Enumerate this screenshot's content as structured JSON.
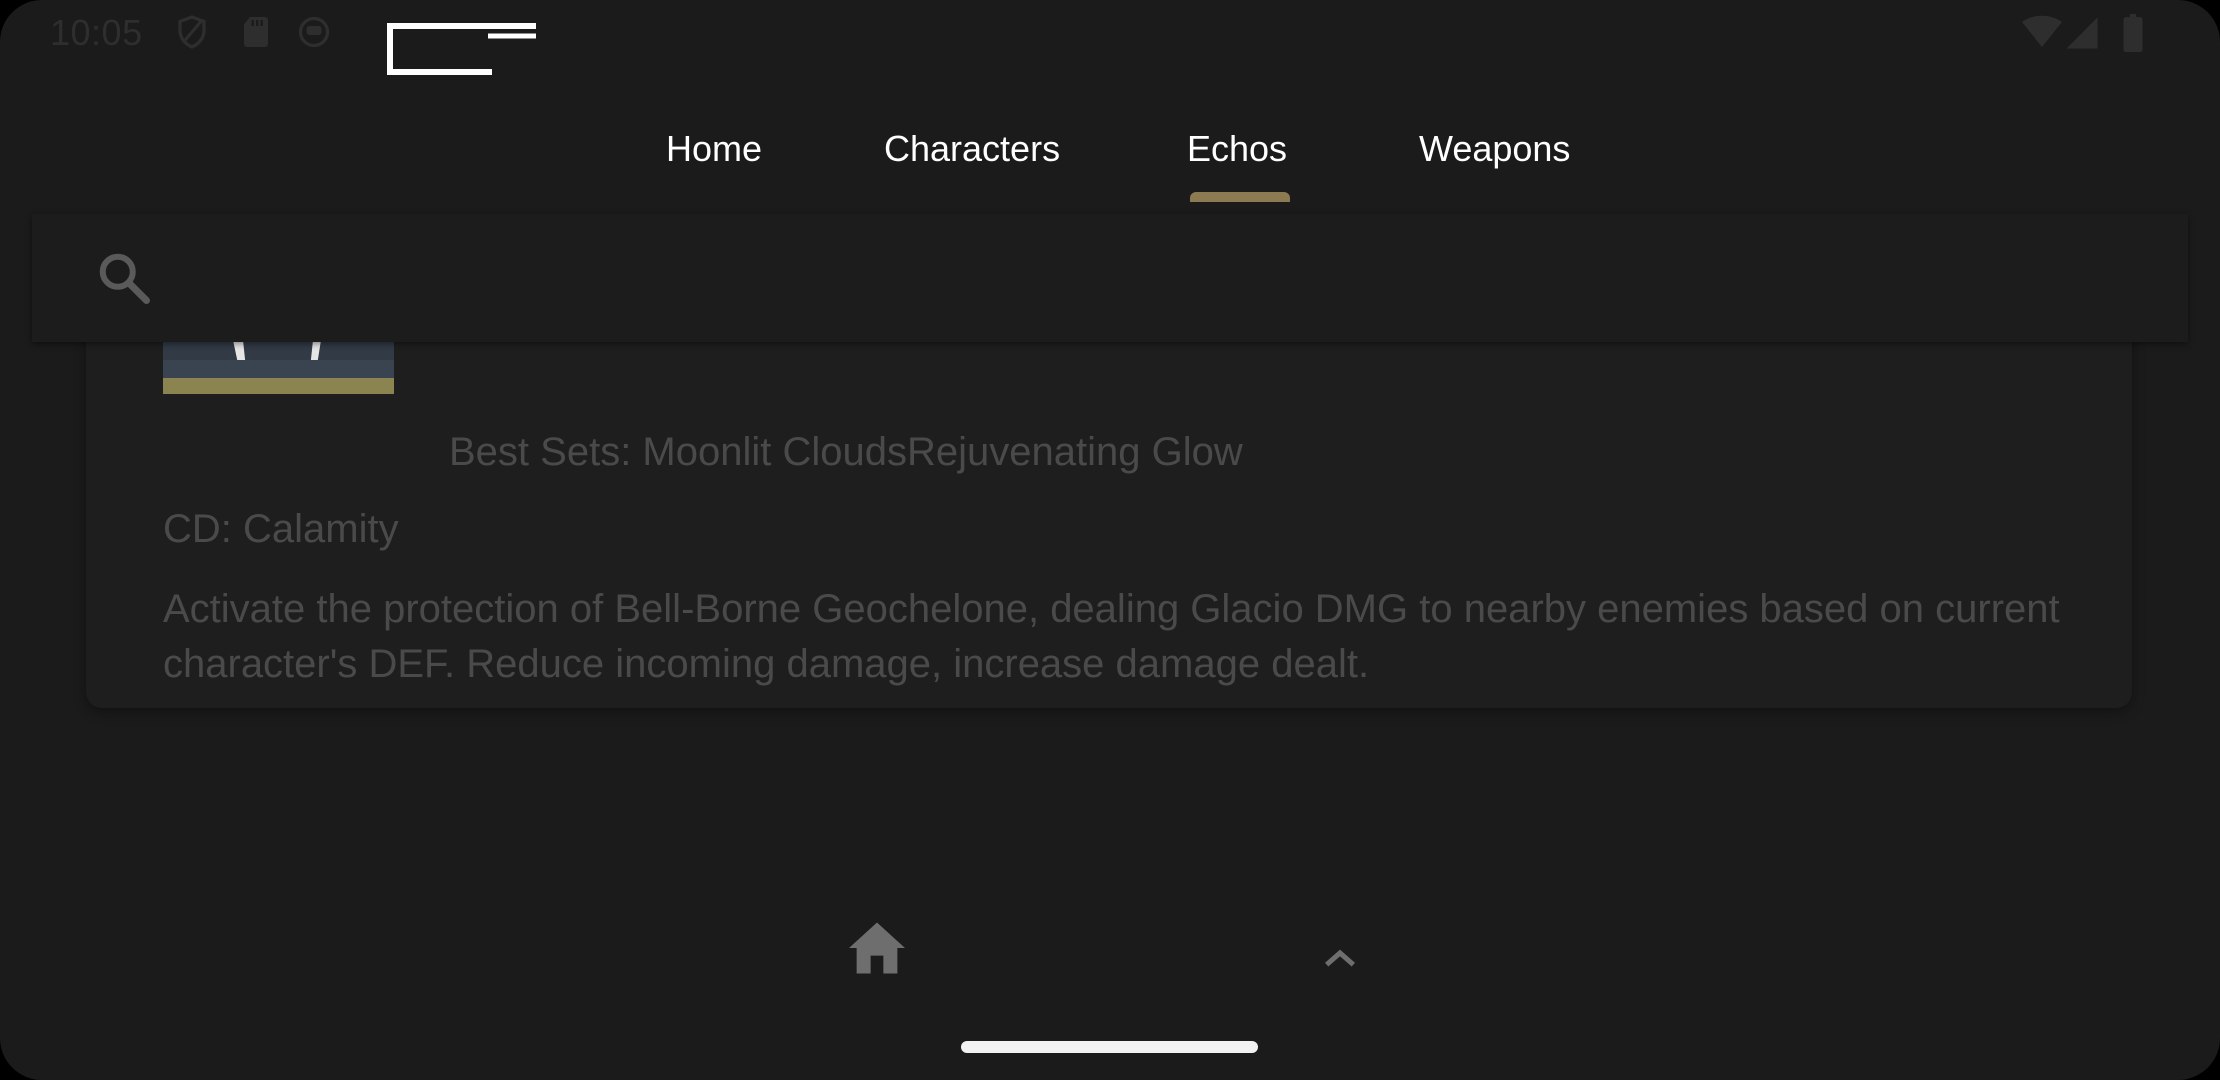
{
  "status_bar": {
    "time": "10:05"
  },
  "tabs": [
    {
      "label": "Home"
    },
    {
      "label": "Characters"
    },
    {
      "label": "Echos"
    },
    {
      "label": "Weapons"
    }
  ],
  "selected_tab": "Echos",
  "colors": {
    "accent": "#8c7a52",
    "background": "#1b1b1b",
    "muted_text": "#4a4a4a"
  },
  "search": {
    "placeholder": "",
    "value": ""
  },
  "echo": {
    "best_sets": "Best Sets: Moonlit CloudsRejuvenating Glow",
    "cd": "CD: Calamity",
    "description": "Activate the protection of Bell-Borne Geochelone, dealing Glacio DMG to nearby enemies based on current character's DEF. Reduce incoming damage, increase damage dealt."
  },
  "icons": {
    "search": "search-icon",
    "home": "home-icon",
    "up": "chevron-up-icon"
  }
}
